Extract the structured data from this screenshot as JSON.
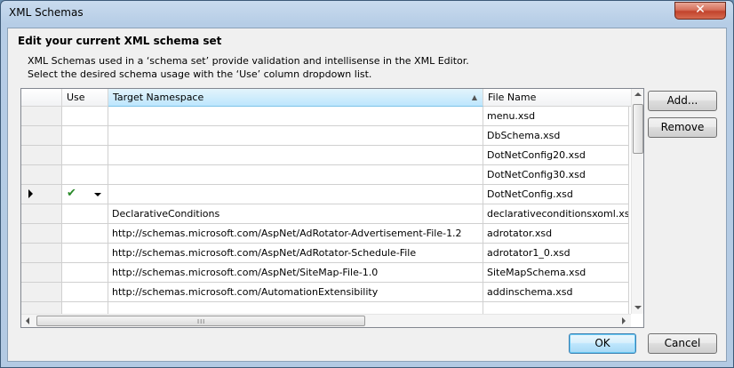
{
  "window": {
    "title": "XML Schemas",
    "close_glyph": "✕"
  },
  "heading": "Edit your current XML schema set",
  "description": [
    "XML Schemas used in a ‘schema set’ provide validation and intellisense in the XML Editor.",
    "Select the desired schema usage with the ‘Use’ column dropdown list."
  ],
  "grid": {
    "columns": {
      "use": "Use",
      "target_namespace": "Target Namespace",
      "file_name": "File Name"
    },
    "sorted_column": "Target Namespace",
    "rows": [
      {
        "current": false,
        "use": "",
        "namespace": "",
        "file": "menu.xsd"
      },
      {
        "current": false,
        "use": "",
        "namespace": "",
        "file": "DbSchema.xsd"
      },
      {
        "current": false,
        "use": "",
        "namespace": "",
        "file": "DotNetConfig20.xsd"
      },
      {
        "current": false,
        "use": "",
        "namespace": "",
        "file": "DotNetConfig30.xsd"
      },
      {
        "current": true,
        "use": "✔",
        "namespace": "",
        "file": "DotNetConfig.xsd"
      },
      {
        "current": false,
        "use": "",
        "namespace": "DeclarativeConditions",
        "file": "declarativeconditionsxoml.xsd"
      },
      {
        "current": false,
        "use": "",
        "namespace": "http://schemas.microsoft.com/AspNet/AdRotator-Advertisement-File-1.2",
        "file": "adrotator.xsd"
      },
      {
        "current": false,
        "use": "",
        "namespace": "http://schemas.microsoft.com/AspNet/AdRotator-Schedule-File",
        "file": "adrotator1_0.xsd"
      },
      {
        "current": false,
        "use": "",
        "namespace": "http://schemas.microsoft.com/AspNet/SiteMap-File-1.0",
        "file": "SiteMapSchema.xsd"
      },
      {
        "current": false,
        "use": "",
        "namespace": "http://schemas.microsoft.com/AutomationExtensibility",
        "file": "addinschema.xsd"
      }
    ],
    "scroll_grip": "III"
  },
  "buttons": {
    "add": "Add...",
    "remove": "Remove",
    "ok": "OK",
    "cancel": "Cancel"
  }
}
